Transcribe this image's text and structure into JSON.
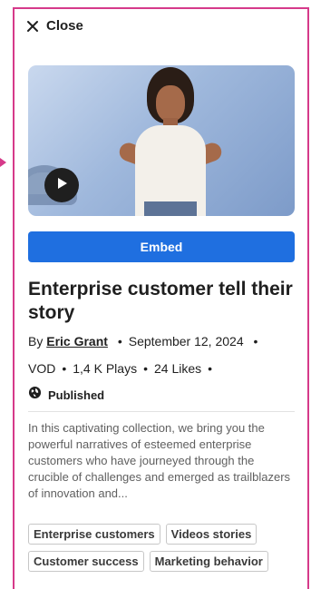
{
  "panel": {
    "close_label": "Close",
    "embed_label": "Embed",
    "title": "Enterprise customer tell their story",
    "by_prefix": "By",
    "author": "Eric Grant",
    "date": "September 12, 2024",
    "type": "VOD",
    "plays": "1,4 K Plays",
    "likes": "24 Likes",
    "bullet": "•",
    "status": "Published",
    "description": "In this captivating collection, we bring you the powerful narratives of esteemed enterprise customers who have journeyed through the crucible of challenges and emerged as trailblazers of innovation and...",
    "tags": [
      "Enterprise customers",
      "Videos stories",
      "Customer success",
      "Marketing behavior"
    ]
  },
  "colors": {
    "accent": "#1f6fe0",
    "frame_highlight": "#d63a8a"
  },
  "icons": {
    "close": "close-icon",
    "play": "play-icon",
    "globe": "globe-icon"
  }
}
